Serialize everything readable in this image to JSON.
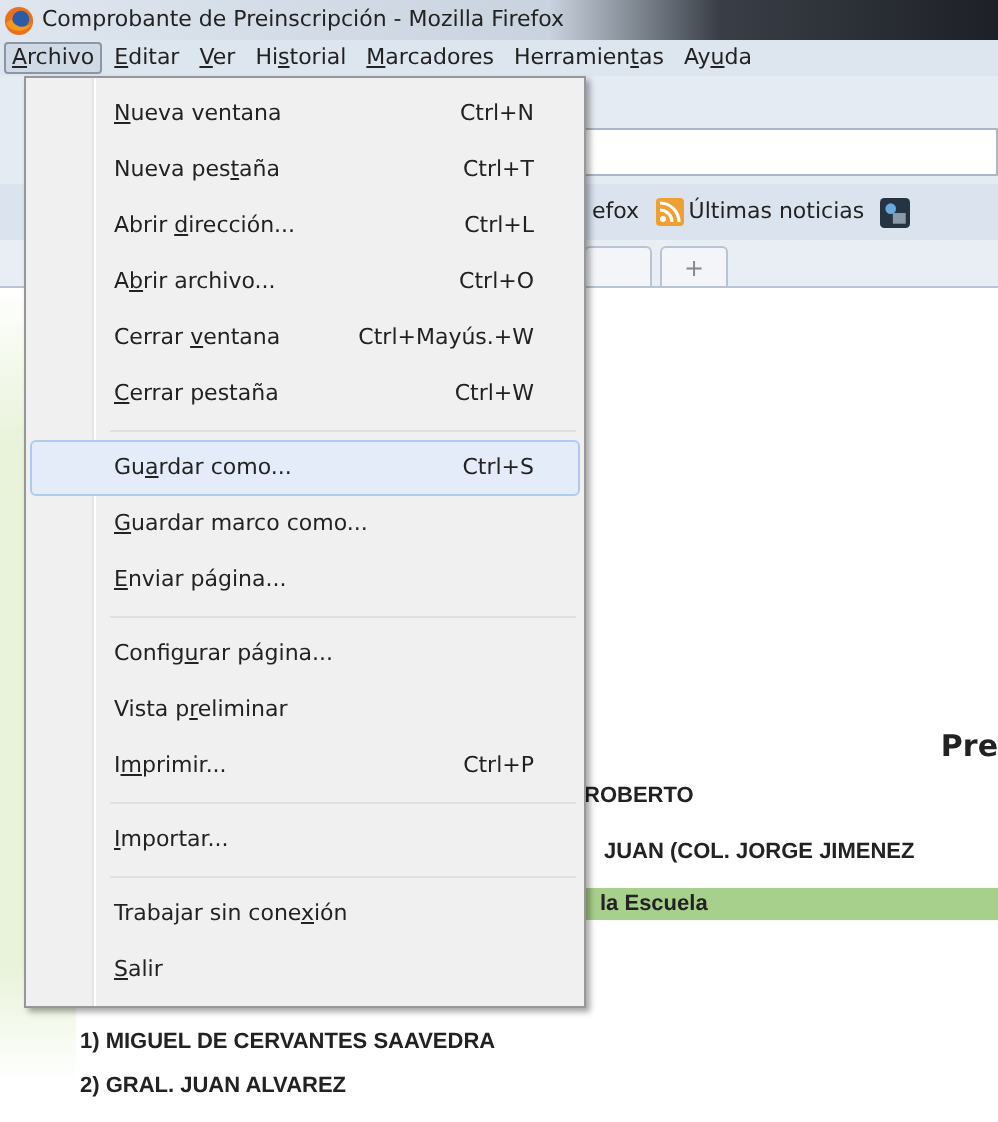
{
  "window": {
    "title": "Comprobante de Preinscripción - Mozilla Firefox"
  },
  "menubar": [
    {
      "label": {
        "key": "A",
        "post": "rchivo"
      },
      "selected": true
    },
    {
      "label": {
        "key": "E",
        "post": "ditar"
      },
      "selected": false
    },
    {
      "label": {
        "key": "V",
        "post": "er"
      },
      "selected": false
    },
    {
      "label": {
        "pre": "Hi",
        "key": "s",
        "post": "torial"
      },
      "selected": false
    },
    {
      "label": {
        "key": "M",
        "post": "arcadores"
      },
      "selected": false
    },
    {
      "label": {
        "pre": "Herramien",
        "key": "t",
        "post": "as"
      },
      "selected": false
    },
    {
      "label": {
        "pre": "Ay",
        "key": "u",
        "post": "da"
      },
      "selected": false
    }
  ],
  "bookmarks": [
    {
      "label": "efox",
      "kind": "text"
    },
    {
      "label": "Últimas noticias",
      "kind": "feed"
    },
    {
      "kind": "iconOnly"
    }
  ],
  "tabs": [
    {
      "kind": "tab"
    },
    {
      "label": "+",
      "kind": "new"
    }
  ],
  "menu": [
    {
      "kind": "item",
      "label": {
        "key": "N",
        "post": "ueva ventana"
      },
      "shortcut": "Ctrl+N",
      "selected": false
    },
    {
      "kind": "item",
      "label": {
        "pre": "Nueva pes",
        "key": "t",
        "post": "aña"
      },
      "shortcut": "Ctrl+T",
      "selected": false
    },
    {
      "kind": "item",
      "label": {
        "pre": "Abrir ",
        "key": "d",
        "post": "irección..."
      },
      "shortcut": "Ctrl+L",
      "selected": false
    },
    {
      "kind": "item",
      "label": {
        "pre": "A",
        "key": "b",
        "post": "rir archivo..."
      },
      "shortcut": "Ctrl+O",
      "selected": false
    },
    {
      "kind": "item",
      "label": {
        "pre": "Cerrar ",
        "key": "v",
        "post": "entana"
      },
      "shortcut": "Ctrl+Mayús.+W",
      "selected": false
    },
    {
      "kind": "item",
      "label": {
        "key": "C",
        "post": "errar pestaña"
      },
      "shortcut": "Ctrl+W",
      "selected": false
    },
    {
      "kind": "separator"
    },
    {
      "kind": "item",
      "label": {
        "pre": "Gu",
        "key": "a",
        "post": "rdar como..."
      },
      "shortcut": "Ctrl+S",
      "selected": true
    },
    {
      "kind": "item",
      "label": {
        "key": "G",
        "post": "uardar marco como..."
      },
      "selected": false
    },
    {
      "kind": "item",
      "label": {
        "key": "E",
        "post": "nviar página..."
      },
      "selected": false
    },
    {
      "kind": "separator"
    },
    {
      "kind": "item",
      "label": {
        "pre": "Config",
        "key": "u",
        "post": "rar página..."
      },
      "selected": false
    },
    {
      "kind": "item",
      "label": {
        "pre": "Vista p",
        "key": "r",
        "post": "eliminar"
      },
      "selected": false
    },
    {
      "kind": "item",
      "label": {
        "pre": "I",
        "key": "m",
        "post": "primir..."
      },
      "shortcut": "Ctrl+P",
      "selected": false
    },
    {
      "kind": "separator"
    },
    {
      "kind": "item",
      "label": {
        "key": "I",
        "post": "mportar..."
      },
      "selected": false
    },
    {
      "kind": "separator"
    },
    {
      "kind": "item",
      "label": {
        "pre": "Trabajar sin cone",
        "key": "x",
        "post": "ión"
      },
      "selected": false
    },
    {
      "kind": "item",
      "label": {
        "key": "S",
        "post": "alir"
      },
      "selected": false
    }
  ],
  "page": {
    "heading": "Pre",
    "lines": [
      {
        "kind": "text",
        "text": "ROBERTO"
      },
      {
        "kind": "text",
        "text": "JUAN (COL. JORGE JIMENEZ"
      },
      {
        "kind": "band",
        "text": "la Escuela"
      },
      {
        "kind": "wide",
        "text": "1) MIGUEL DE CERVANTES SAAVEDRA"
      },
      {
        "kind": "wide",
        "text": "2) GRAL. JUAN ALVAREZ"
      }
    ]
  }
}
